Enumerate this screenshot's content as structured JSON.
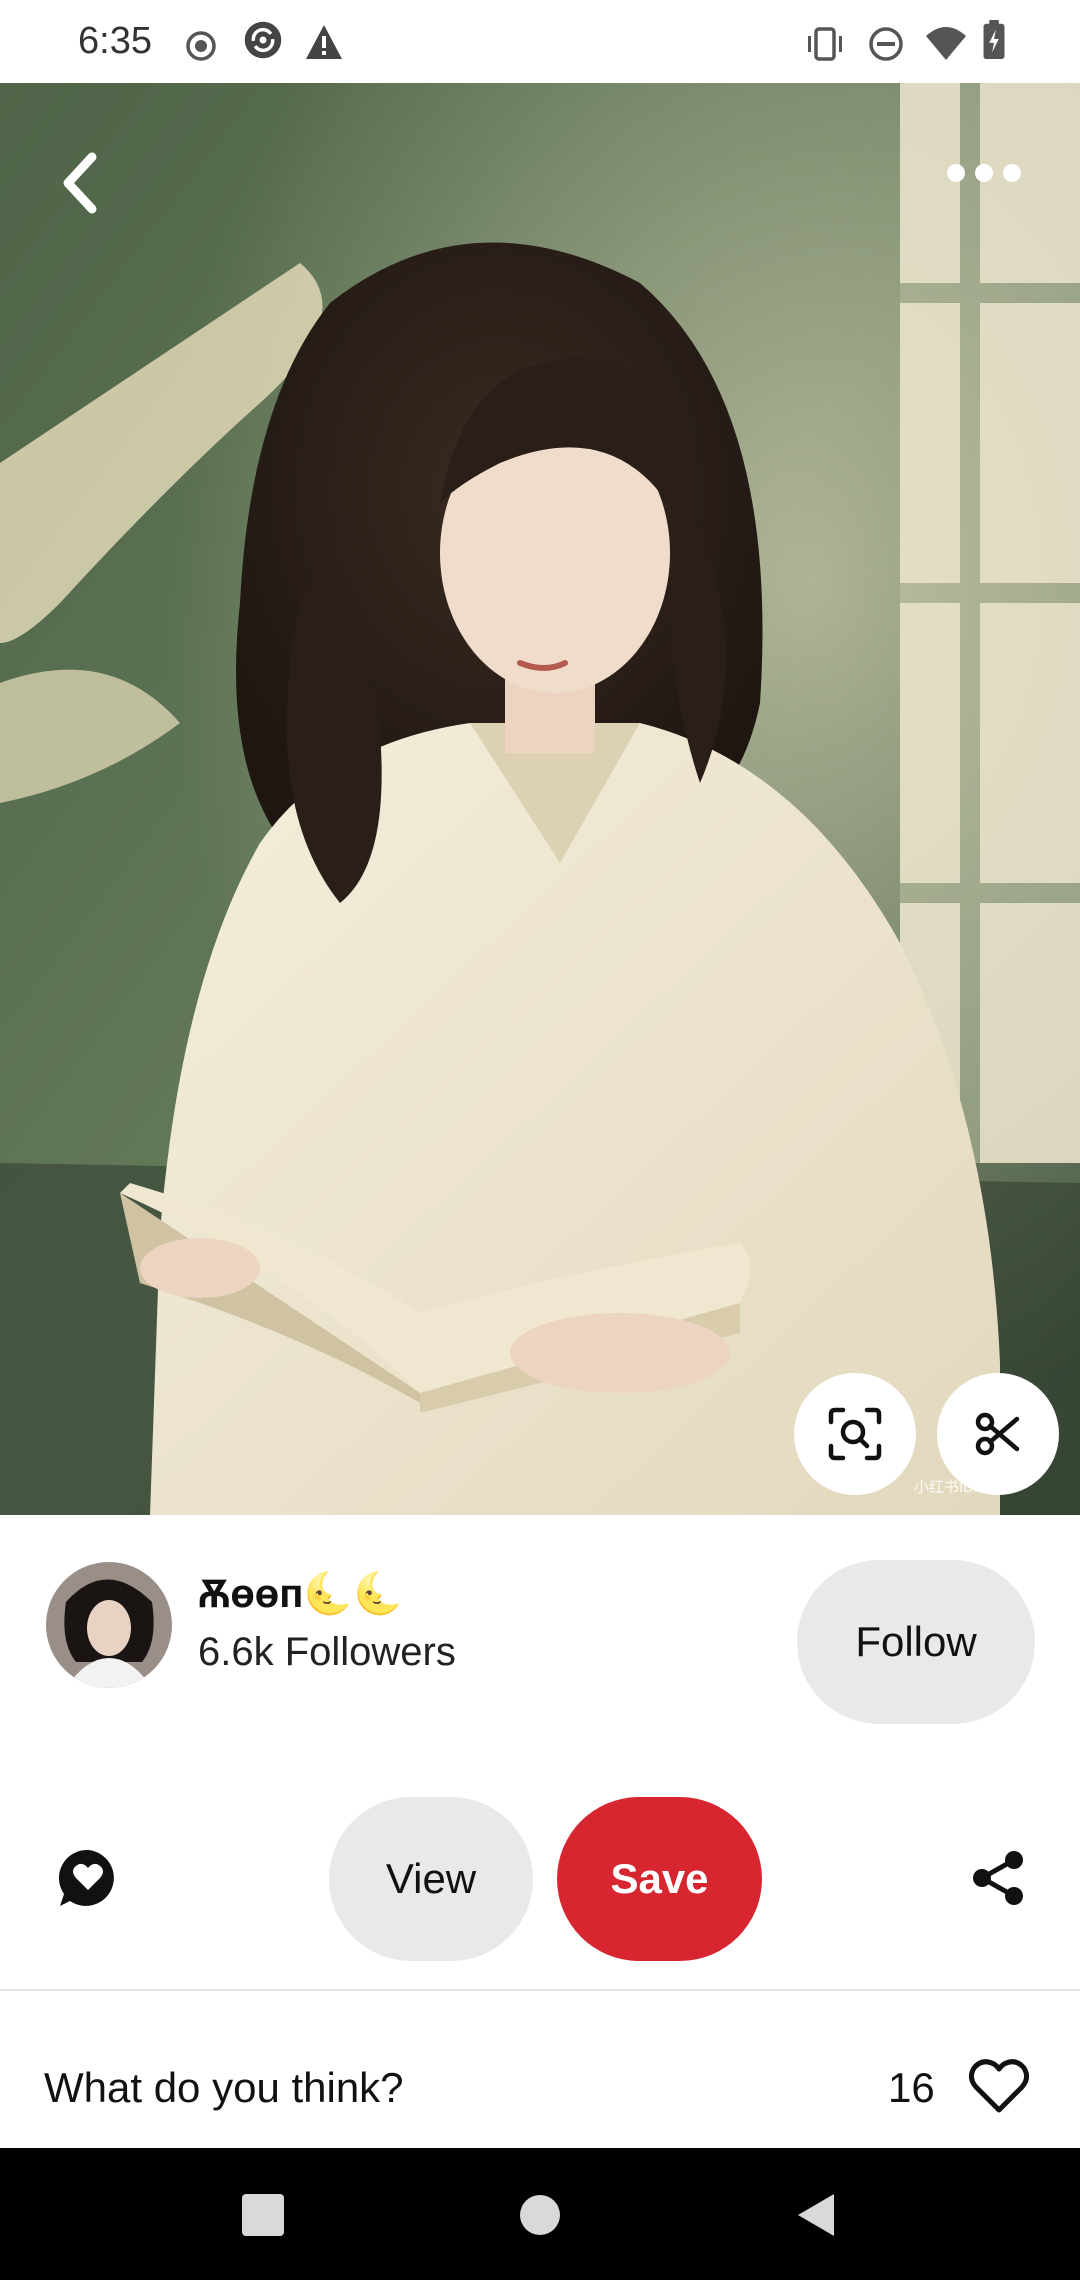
{
  "status_bar": {
    "time": "6:35",
    "left_icons": [
      "record-icon",
      "sync-app-icon",
      "warning-icon"
    ],
    "right_icons": [
      "vibrate-icon",
      "do-not-disturb-icon",
      "wifi-icon",
      "battery-icon"
    ]
  },
  "hero": {
    "image_description_icon": "artwork-image",
    "watermark": "小红书ID: aigc",
    "buttons": [
      "back-icon",
      "more-icon",
      "visual-search-icon",
      "scissors-icon"
    ]
  },
  "creator": {
    "name": "Ѫɵɵп🌜🌜",
    "followers": "6.6k Followers",
    "follow_label": "Follow"
  },
  "actions": {
    "view_label": "View",
    "save_label": "Save",
    "save_color": "#d7262f"
  },
  "comments": {
    "prompt": "What do you think?",
    "like_count": "16"
  }
}
